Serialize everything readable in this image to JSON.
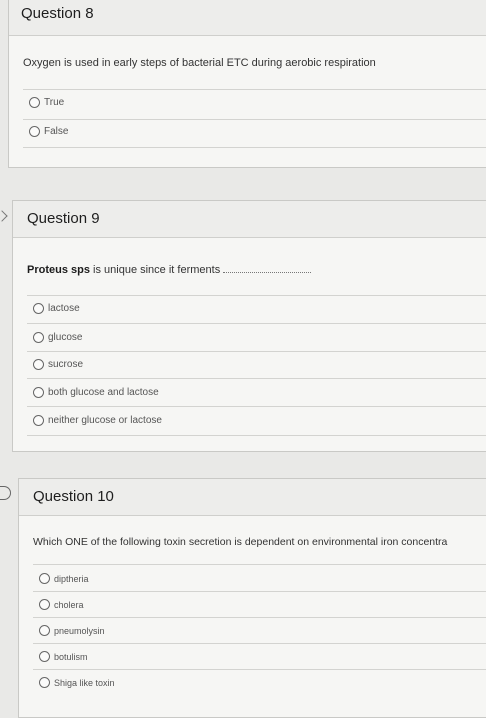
{
  "questions": [
    {
      "title": "Question 8",
      "prompt": "Oxygen is used in early steps of bacterial ETC during aerobic respiration",
      "options": [
        "True",
        "False"
      ]
    },
    {
      "title": "Question 9",
      "prompt_bold": "Proteus sps",
      "prompt": " is unique since it ferments",
      "options": [
        "lactose",
        "glucose",
        "sucrose",
        "both glucose and lactose",
        "neither glucose or lactose"
      ]
    },
    {
      "title": "Question 10",
      "prompt": "Which ONE of the following toxin secretion is dependent on environmental iron concentra",
      "options": [
        "diptheria",
        "cholera",
        "pneumolysin",
        "botulism",
        "Shiga like toxin"
      ]
    }
  ]
}
